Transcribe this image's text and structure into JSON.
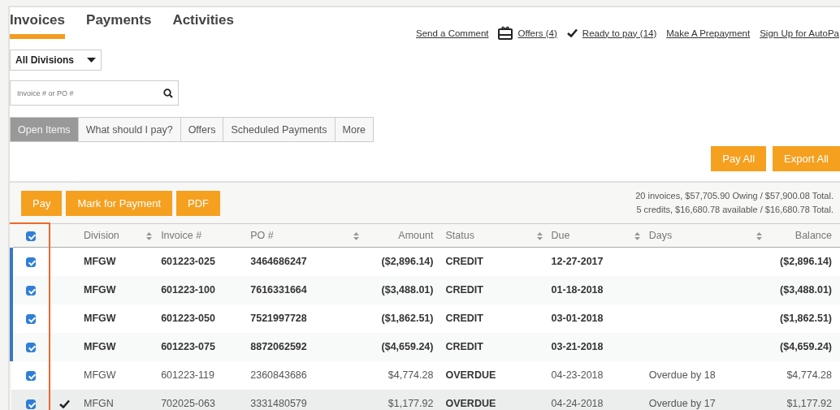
{
  "tabs": [
    {
      "label": "Invoices",
      "selected": true
    },
    {
      "label": "Payments",
      "selected": false
    },
    {
      "label": "Activities",
      "selected": false
    }
  ],
  "links": [
    {
      "label": "Send a Comment",
      "kind": "plain"
    },
    {
      "label": "Offers (4)",
      "kind": "gift"
    },
    {
      "label": "Ready to pay (14)",
      "kind": "check"
    },
    {
      "label": "Make A Prepayment",
      "kind": "plain"
    },
    {
      "label": "Sign Up for AutoPa",
      "kind": "plain"
    }
  ],
  "division_select": {
    "value": "All Divisions"
  },
  "search": {
    "placeholder": "Invoice # or PO #"
  },
  "views": [
    {
      "label": "Open Items",
      "selected": true
    },
    {
      "label": "What should I pay?",
      "selected": false
    },
    {
      "label": "Offers",
      "selected": false
    },
    {
      "label": "Scheduled Payments",
      "selected": false
    },
    {
      "label": "More",
      "selected": false
    }
  ],
  "top_actions": [
    "Pay All",
    "Export All"
  ],
  "table_actions": [
    "Pay",
    "Mark for Payment",
    "PDF"
  ],
  "summary": [
    "20 invoices, $57,705.90 Owing / $57,900.08 Total.",
    "5 credits, $16,680.78 available / $16,680.78 Total."
  ],
  "select_all": {
    "checked": true
  },
  "columns": [
    {
      "label": "Division",
      "sortable": true
    },
    {
      "label": "Invoice #",
      "sortable": false
    },
    {
      "label": "PO #",
      "sortable": true
    },
    {
      "label": "Amount",
      "sortable": false
    },
    {
      "label": "Status",
      "sortable": true
    },
    {
      "label": "Due",
      "sortable": true
    },
    {
      "label": "Days",
      "sortable": true
    },
    {
      "label": "Balance",
      "sortable": false
    }
  ],
  "rows": [
    {
      "kind": "credit",
      "checked": true,
      "marked": false,
      "cells": [
        "MFGW",
        "601223-025",
        "3464686247",
        "($2,896.14)",
        "CREDIT",
        "12-27-2017",
        "",
        "($2,896.14)"
      ]
    },
    {
      "kind": "credit",
      "checked": true,
      "marked": false,
      "cells": [
        "MFGW",
        "601223-100",
        "7616331664",
        "($3,488.01)",
        "CREDIT",
        "01-18-2018",
        "",
        "($3,488.01)"
      ]
    },
    {
      "kind": "credit",
      "checked": true,
      "marked": false,
      "cells": [
        "MFGW",
        "601223-050",
        "7521997728",
        "($1,862.51)",
        "CREDIT",
        "03-01-2018",
        "",
        "($1,862.51)"
      ]
    },
    {
      "kind": "credit",
      "checked": true,
      "marked": false,
      "cells": [
        "MFGW",
        "601223-075",
        "8872062592",
        "($4,659.24)",
        "CREDIT",
        "03-21-2018",
        "",
        "($4,659.24)"
      ]
    },
    {
      "kind": "invoice",
      "checked": true,
      "marked": false,
      "cells": [
        "MFGW",
        "601223-119",
        "2360843686",
        "$4,774.28",
        "OVERDUE",
        "04-23-2018",
        "Overdue by 18",
        "$4,774.28"
      ]
    },
    {
      "kind": "invoice",
      "checked": true,
      "marked": true,
      "cells": [
        "MFGN",
        "702025-063",
        "3331480579",
        "$1,177.92",
        "OVERDUE",
        "04-24-2018",
        "Overdue by 17",
        "$1,177.92"
      ]
    }
  ]
}
